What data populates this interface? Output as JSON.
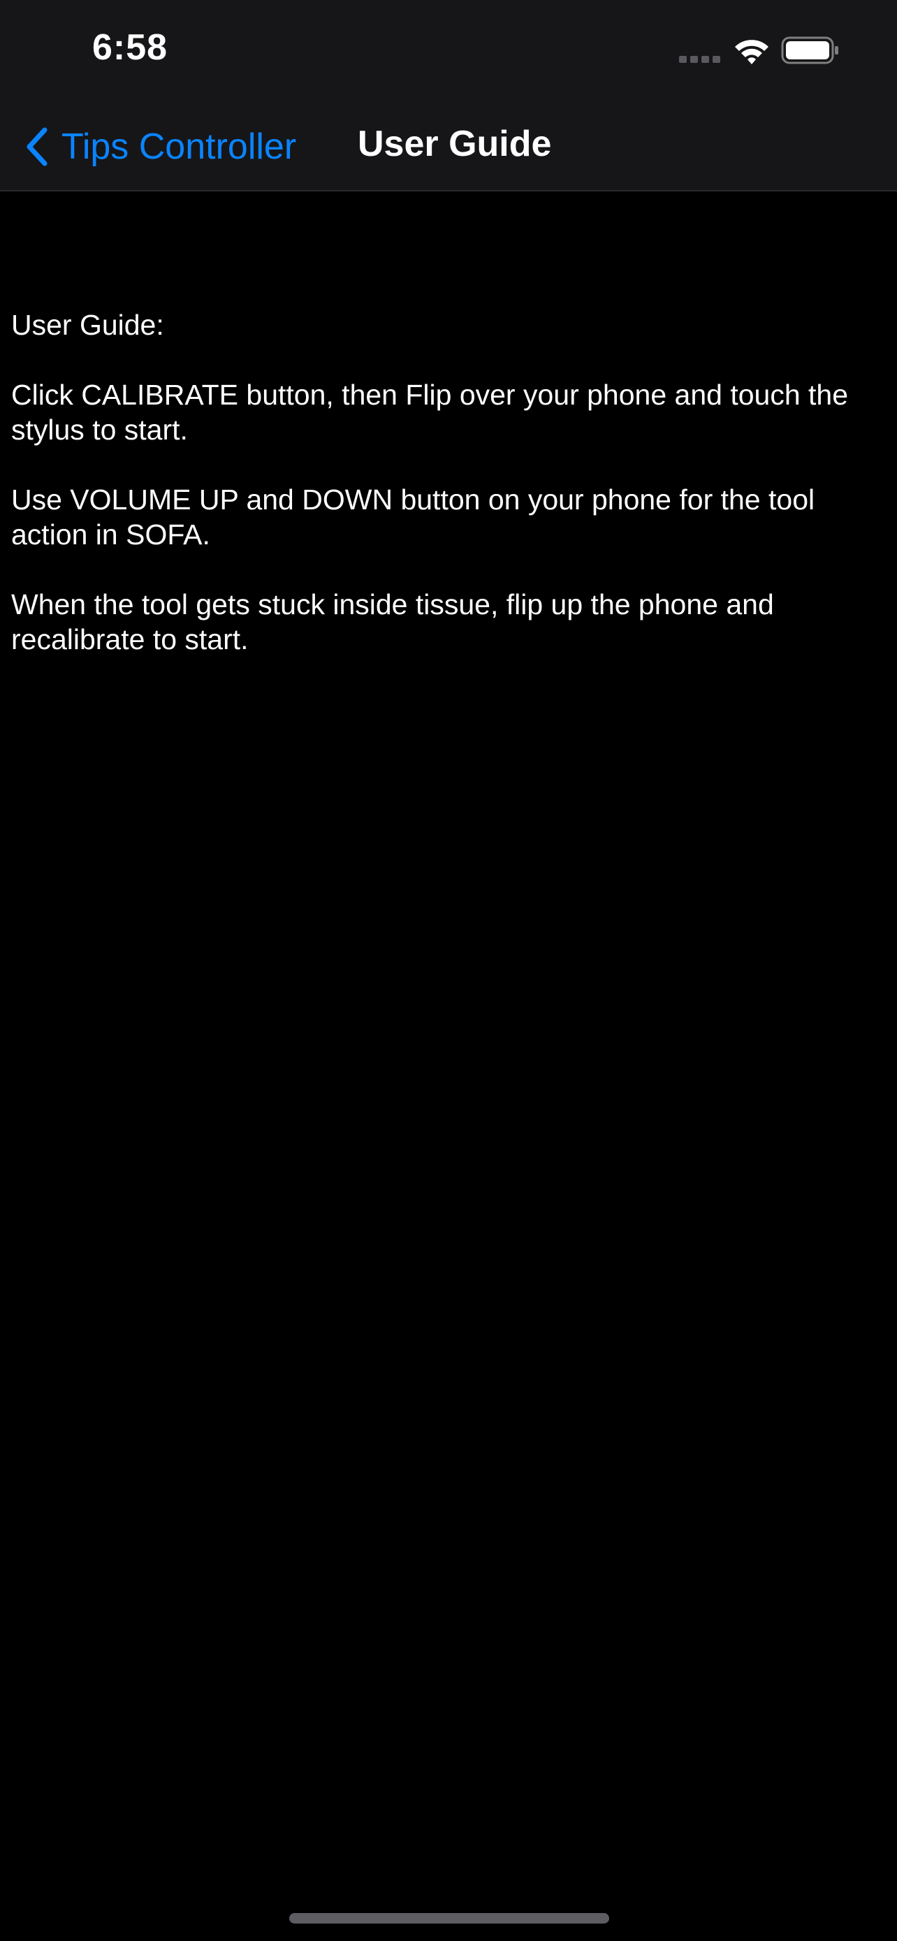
{
  "status_bar": {
    "time": "6:58",
    "icons": [
      "cellular-signal-icon",
      "wifi-icon",
      "battery-icon"
    ]
  },
  "nav_bar": {
    "back_label": "Tips Controller",
    "title": "User Guide",
    "accent_color": "#0a84ff"
  },
  "guide": {
    "heading": "User Guide:",
    "paragraphs": [
      "Click CALIBRATE button, then Flip over your phone and touch the stylus to start.",
      "Use VOLUME UP and DOWN button on your phone for the tool action in SOFA.",
      "When the tool gets stuck inside tissue, flip up the phone and recalibrate to start."
    ]
  }
}
